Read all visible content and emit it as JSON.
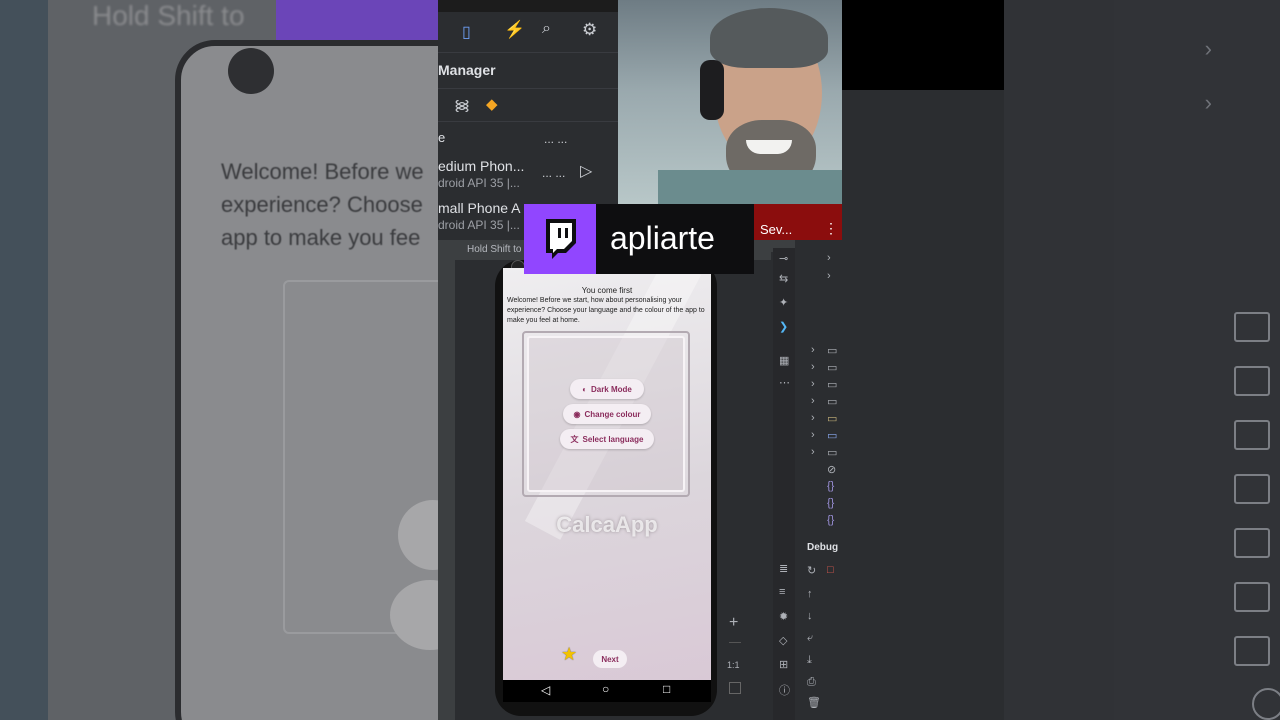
{
  "background": {
    "hint_text": "Hold Shift to",
    "welcome_text": "Welcome! Before we experience? Choose app to make you fee"
  },
  "device_manager": {
    "title": "Manager",
    "search_partial": "e",
    "devices": [
      {
        "name": "edium Phon...",
        "sub": "droid API 35 |..."
      },
      {
        "name": "mall Phone A",
        "sub": "droid API 35 |..."
      }
    ],
    "more": "... ..."
  },
  "stream": {
    "channel": "apliarte",
    "side_label": "Sev..."
  },
  "emulator": {
    "tooltip": "Hold Shift to",
    "zoom_label": "1:1",
    "app": {
      "heading": "You come first",
      "body": "Welcome! Before we start, how about personalising your experience? Choose your language and the colour of the app to make you feel at home.",
      "buttons": {
        "dark_mode": "Dark Mode",
        "change_colour": "Change colour",
        "select_language": "Select language"
      },
      "app_name": "CalcaApp",
      "next_label": "Next"
    }
  },
  "ide": {
    "debug_label": "Debug"
  },
  "colors": {
    "twitch_purple": "#9146ff",
    "accent_magenta": "#8b2d5d"
  }
}
